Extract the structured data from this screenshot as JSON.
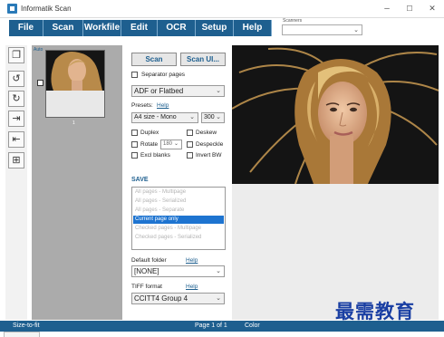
{
  "window": {
    "title": "Informatik Scan",
    "minimize": "–",
    "maximize": "☐",
    "close": "✕"
  },
  "menu": [
    {
      "label": "File",
      "w": 38
    },
    {
      "label": "Scan",
      "w": 44
    },
    {
      "label": "Workfile",
      "w": 42
    },
    {
      "label": "Edit",
      "w": 40
    },
    {
      "label": "OCR",
      "w": 42
    },
    {
      "label": "Setup",
      "w": 42
    },
    {
      "label": "Help",
      "w": 42
    }
  ],
  "scanners": {
    "label": "Scanners",
    "value": ""
  },
  "tools": [
    {
      "name": "page-icon",
      "glyph": "❐"
    },
    {
      "name": "rotate-left-icon",
      "glyph": "↺"
    },
    {
      "name": "rotate-right-icon",
      "glyph": "↻"
    },
    {
      "name": "export-icon",
      "glyph": "⇥"
    },
    {
      "name": "import-icon",
      "glyph": "⇤"
    },
    {
      "name": "merge-icon",
      "glyph": "⊞"
    }
  ],
  "thumbnails": {
    "auto_label": "Auto",
    "page_number": "1"
  },
  "controls": {
    "scan_button": "Scan",
    "scan_ui_button": "Scan UI...",
    "separator_pages": "Separator pages",
    "source": "ADF or Flatbed",
    "presets_label": "Presets:",
    "presets_help": "Help",
    "page_size": "A4 size - Mono",
    "dpi": "300",
    "duplex": "Duplex",
    "deskew": "Deskew",
    "rotate": "Rotate",
    "rotate_value": "180",
    "despeckle": "Despeckle",
    "excl_blanks": "Excl blanks",
    "invert_bw": "Invert BW"
  },
  "save": {
    "heading": "SAVE",
    "options": [
      "All pages - Multipage",
      "All pages - Serialized",
      "All pages - Separate",
      "Current page only",
      "Checked pages - Multipage",
      "Checked pages - Serialized"
    ],
    "selected_index": 3,
    "default_folder_label": "Default folder",
    "default_folder_help": "Help",
    "default_folder_value": "[NONE]",
    "tiff_label": "TIFF format",
    "tiff_help": "Help",
    "tiff_value": "CCITT4 Group 4"
  },
  "status": {
    "zoom": "Size-to-fit",
    "page": "Page 1 of 1",
    "mode": "Color"
  },
  "watermark": "最需教育"
}
